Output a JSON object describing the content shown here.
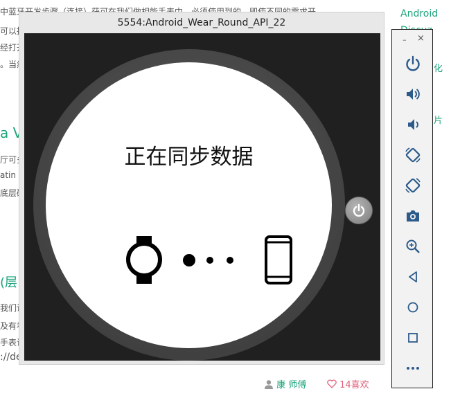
{
  "background": {
    "lines": [
      "中蓝牙开发步骤（连接）获可在我们做相能手表中，必须使用到的。即使不同的需求开",
      "可以把",
      "经打开",
      "。当然",
      "厅可多",
      "atin",
      "底层研",
      "我们说",
      "及有看",
      "手表说",
      "://de"
    ],
    "heading_1": "a V",
    "heading_2": "(层",
    "right_links": [
      "Android",
      "Discuz"
    ],
    "right_frag_1": "化",
    "right_frag_2": "片"
  },
  "emulator": {
    "title": "5554:Android_Wear_Round_API_22",
    "screen_text": "正在同步数据"
  },
  "toolbar": {
    "minimize": "–",
    "close": "×",
    "buttons": [
      "power-icon",
      "volume-up-icon",
      "volume-down-icon",
      "rotate-left-icon",
      "rotate-right-icon",
      "camera-icon",
      "zoom-icon",
      "back-icon",
      "home-icon",
      "overview-icon",
      "more-icon"
    ]
  },
  "footer": {
    "author": "康 师傅",
    "likes": "14喜欢"
  },
  "colors": {
    "accent_green": "#1aa37a",
    "like_pink": "#e0607a"
  }
}
